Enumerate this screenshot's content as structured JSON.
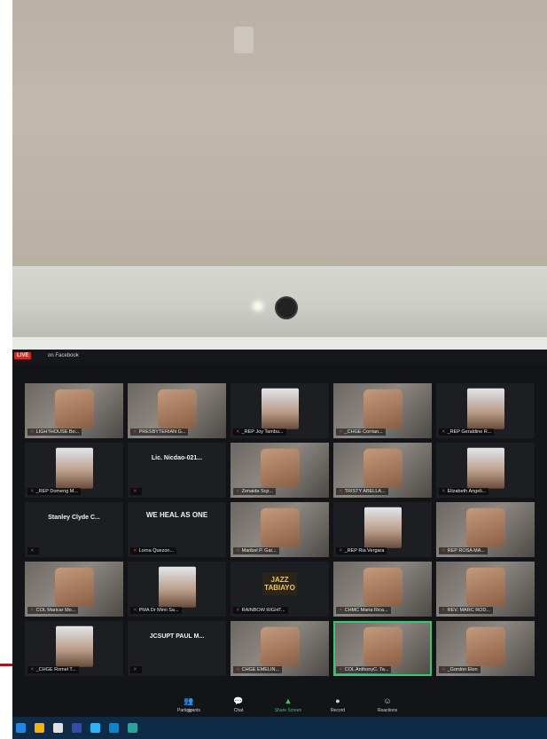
{
  "scene": {
    "live_badge": "LIVE",
    "live_text": "on Facebook"
  },
  "participants": [
    {
      "name": "LIGHTHOUSE Bo...",
      "kind": "video"
    },
    {
      "name": "PRESBYTERIAN G...",
      "kind": "video"
    },
    {
      "name": "_REP Joy Tambu...",
      "kind": "photo"
    },
    {
      "name": "_CHGE Corrian...",
      "kind": "video"
    },
    {
      "name": "_REP Geraldine R...",
      "kind": "photo"
    },
    {
      "name": "_REP Domeng M...",
      "kind": "photo"
    },
    {
      "name": "",
      "kind": "text",
      "banner": "Lic. Nicdao-021..."
    },
    {
      "name": "Zenaida Scp...",
      "kind": "video"
    },
    {
      "name": "TRISTY ABELLA...",
      "kind": "video"
    },
    {
      "name": "Elizabeth Angeli...",
      "kind": "photo"
    },
    {
      "name": "",
      "kind": "text",
      "banner": "Stanley Clyde C..."
    },
    {
      "name": "Lorna Quezon...",
      "kind": "text",
      "banner": "WE HEAL AS ONE"
    },
    {
      "name": "Maribel P. Gar...",
      "kind": "video"
    },
    {
      "name": "_REP Ria Vergara",
      "kind": "photo"
    },
    {
      "name": "REP ROSA MA...",
      "kind": "video"
    },
    {
      "name": "COL Maricar Mo...",
      "kind": "video"
    },
    {
      "name": "PMA Dr Mimi Sa...",
      "kind": "photo"
    },
    {
      "name": "RAINBOW RIGHT...",
      "kind": "text",
      "banner": "JAZZ TABIAYO"
    },
    {
      "name": "CHMC Maria Rica...",
      "kind": "video"
    },
    {
      "name": "REV. MARC ROD...",
      "kind": "video"
    },
    {
      "name": "_CHGE Romel T...",
      "kind": "photo"
    },
    {
      "name": "",
      "kind": "text",
      "banner": "JCSUPT PAUL M..."
    },
    {
      "name": "CHGE EMELIN...",
      "kind": "video"
    },
    {
      "name": "COL AnthonyC. Ta...",
      "kind": "video",
      "active": true
    },
    {
      "name": "_Gordon Elon",
      "kind": "video"
    }
  ],
  "controls": [
    {
      "label": "Participants",
      "icon": "participants-icon",
      "glyph": "👥",
      "count": "87"
    },
    {
      "label": "Chat",
      "icon": "chat-icon",
      "glyph": "💬"
    },
    {
      "label": "Share Screen",
      "icon": "share-screen-icon",
      "glyph": "▲",
      "accent": true
    },
    {
      "label": "Record",
      "icon": "record-icon",
      "glyph": "●"
    },
    {
      "label": "Reactions",
      "icon": "reactions-icon",
      "glyph": "☺"
    }
  ],
  "taskbar_colors": [
    "#1e88e5",
    "#f4b400",
    "#e0e0e0",
    "#3949ab",
    "#29b6f6",
    "#0288d1",
    "#26a69a"
  ],
  "colors": {
    "live_red": "#d7261e",
    "accent_green": "#2ecc71",
    "mic_muted_red": "#e0362c"
  }
}
